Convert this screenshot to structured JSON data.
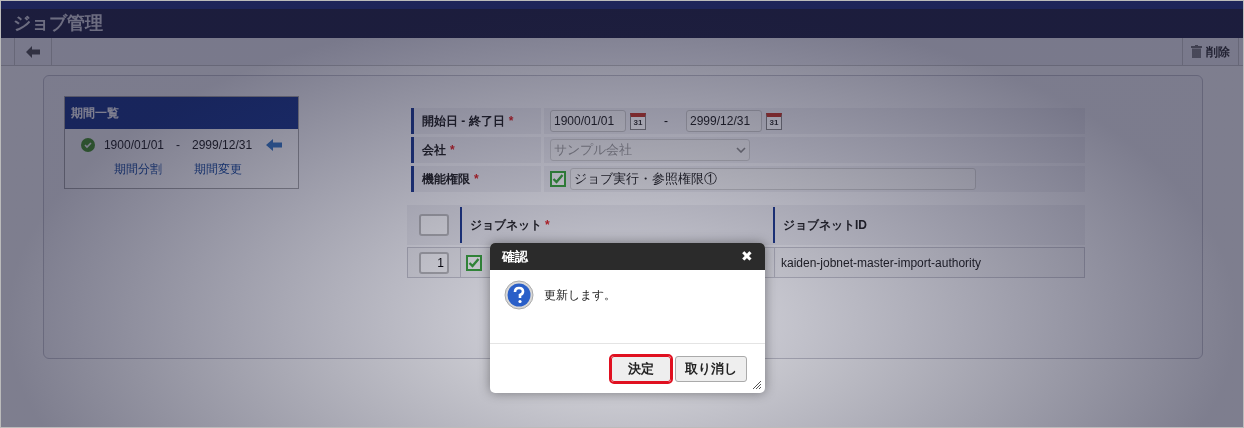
{
  "header": {
    "title": "ジョブ管理"
  },
  "toolbar": {
    "delete_label": "削除"
  },
  "period_list": {
    "title": "期間一覧",
    "items": [
      {
        "start": "1900/01/01",
        "separator": "-",
        "end": "2999/12/31",
        "current": true
      }
    ],
    "links": [
      "期間分割",
      "期間変更"
    ]
  },
  "form": {
    "fields": [
      {
        "kind": "daterange",
        "label": "開始日 - 終了日",
        "required": "*",
        "start": "1900/01/01",
        "start_calendar_day": "31",
        "separator": "-",
        "end": "2999/12/31",
        "end_calendar_day": "31"
      },
      {
        "kind": "select",
        "label": "会社",
        "required": "*",
        "value": "サンプル会社",
        "disabled": true
      },
      {
        "kind": "checkbox",
        "label": "機能権限",
        "required": "*",
        "value": "ジョブ実行・参照権限①",
        "checked": true
      }
    ]
  },
  "table": {
    "columns": [
      {
        "label": "ジョブネット",
        "required": "*"
      },
      {
        "label": "ジョブネットID"
      }
    ],
    "rows": [
      {
        "number": "1",
        "checked": true,
        "jobnet_id": "kaiden-jobnet-master-import-authority"
      }
    ]
  },
  "dialog": {
    "title": "確認",
    "close": "✖",
    "message": "更新します。",
    "buttons": [
      {
        "label": "決定",
        "focused": true
      },
      {
        "label": "取り消し",
        "focused": false
      }
    ]
  }
}
